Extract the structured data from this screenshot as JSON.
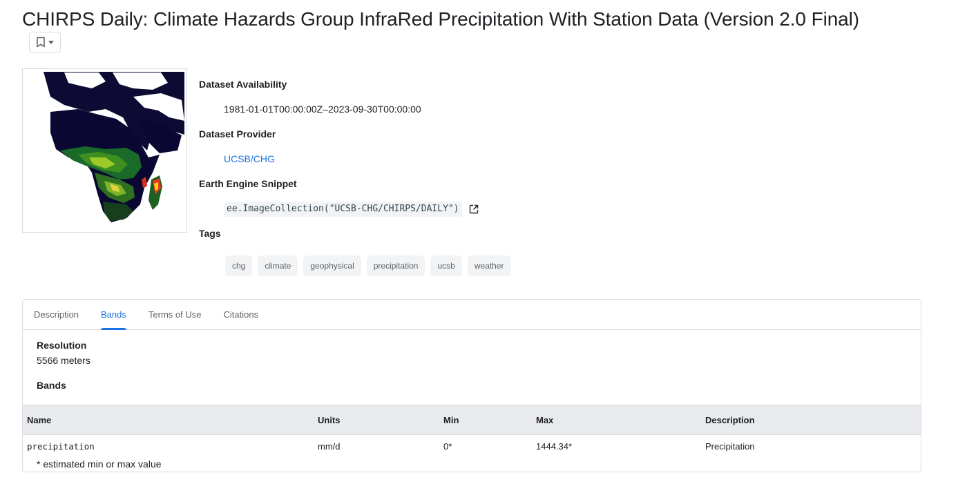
{
  "page": {
    "title": "CHIRPS Daily: Climate Hazards Group InfraRed Precipitation With Station Data (Version 2.0 Final)"
  },
  "bookmark": {
    "icon": "bookmark-icon",
    "menu_icon": "caret-down-icon"
  },
  "thumbnail": {
    "alt": "Africa precipitation map"
  },
  "metadata": {
    "availability_label": "Dataset Availability",
    "availability_value": "1981-01-01T00:00:00Z–2023-09-30T00:00:00",
    "provider_label": "Dataset Provider",
    "provider_value": "UCSB/CHG",
    "snippet_label": "Earth Engine Snippet",
    "snippet_value": "ee.ImageCollection(\"UCSB-CHG/CHIRPS/DAILY\")",
    "snippet_icon": "open-in-new-icon",
    "tags_label": "Tags",
    "tags": [
      "chg",
      "climate",
      "geophysical",
      "precipitation",
      "ucsb",
      "weather"
    ]
  },
  "tabs": [
    {
      "label": "Description",
      "active": false
    },
    {
      "label": "Bands",
      "active": true
    },
    {
      "label": "Terms of Use",
      "active": false
    },
    {
      "label": "Citations",
      "active": false
    }
  ],
  "bands_panel": {
    "resolution_label": "Resolution",
    "resolution_value": "5566 meters",
    "bands_label": "Bands",
    "columns": [
      "Name",
      "Units",
      "Min",
      "Max",
      "Description"
    ],
    "rows": [
      {
        "name": "precipitation",
        "units": "mm/d",
        "min": "0*",
        "max": "1444.34*",
        "description": "Precipitation"
      }
    ],
    "footnote": "* estimated min or max value"
  },
  "colors": {
    "accent": "#1a73e8",
    "text": "#202124",
    "muted": "#5f6368",
    "border": "#dadce0",
    "chip_bg": "#f1f3f4"
  }
}
